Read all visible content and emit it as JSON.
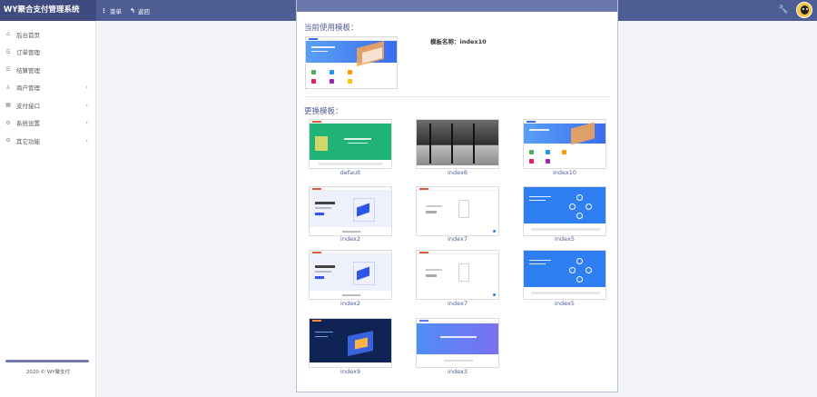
{
  "app": {
    "title": "WY聚合支付管理系统"
  },
  "topnav": {
    "menu_label": "菜单",
    "back_label": "返回"
  },
  "sidebar": {
    "items": [
      {
        "label": "后台首页",
        "icon": "home-icon",
        "has_children": false
      },
      {
        "label": "订单管理",
        "icon": "list-icon",
        "has_children": false
      },
      {
        "label": "结算管理",
        "icon": "list-icon",
        "has_children": false
      },
      {
        "label": "商户管理",
        "icon": "user-icon",
        "has_children": true
      },
      {
        "label": "支付接口",
        "icon": "grid-icon",
        "has_children": true
      },
      {
        "label": "系统设置",
        "icon": "gear-icon",
        "has_children": true
      },
      {
        "label": "其它功能",
        "icon": "gears-icon",
        "has_children": true
      }
    ],
    "copyright": "2020 © WY聚支付"
  },
  "main": {
    "current_title": "当前使用模板：",
    "template_name": "模板名称：index10",
    "switch_title": "更换模板：",
    "templates": [
      {
        "name": "default"
      },
      {
        "name": "index6"
      },
      {
        "name": "index10"
      },
      {
        "name": "index2"
      },
      {
        "name": "index7"
      },
      {
        "name": "index5"
      },
      {
        "name": "index2"
      },
      {
        "name": "index7"
      },
      {
        "name": "index5"
      },
      {
        "name": "index9"
      },
      {
        "name": "index3"
      }
    ]
  },
  "colors": {
    "header": "#4f5d95",
    "brand": "#3f4b7e",
    "accent": "#4f5d95"
  }
}
